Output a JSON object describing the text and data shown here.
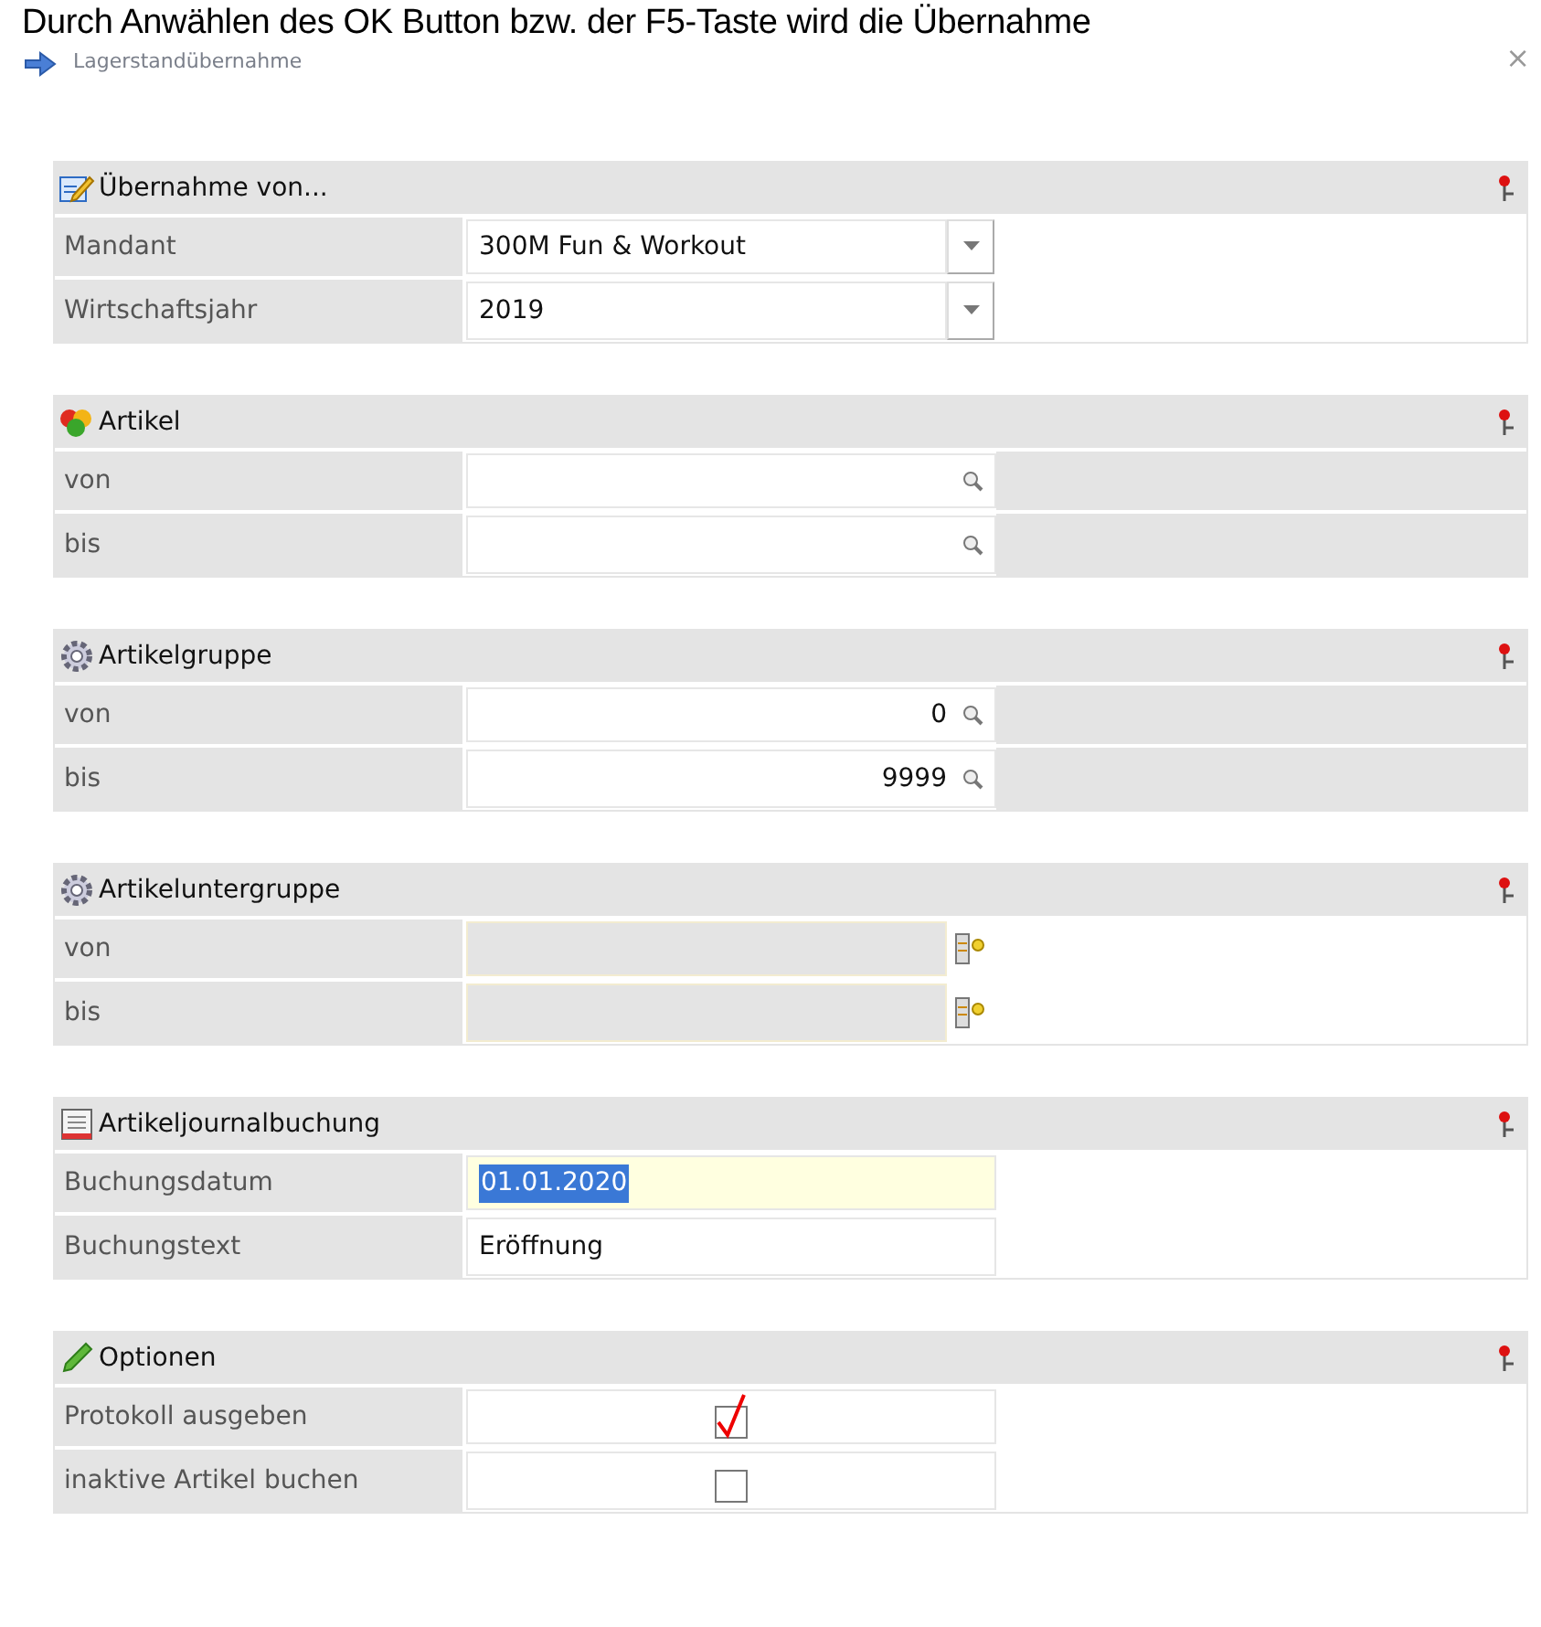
{
  "overlay_text": "Durch Anwählen des OK Button bzw. der F5-Taste wird die Übernahme",
  "window": {
    "title": "Lagerstandübernahme",
    "close": "×"
  },
  "sections": [
    {
      "title": "Übernahme von...",
      "shaded": false,
      "rows": [
        {
          "label": "Mandant",
          "kind": "select",
          "value": "300M Fun & Workout"
        },
        {
          "label": "Wirtschaftsjahr",
          "kind": "select",
          "value": "2019"
        }
      ]
    },
    {
      "title": "Artikel",
      "shaded": true,
      "rows": [
        {
          "label": "von",
          "kind": "lookup"
        },
        {
          "label": "bis",
          "kind": "lookup"
        }
      ]
    },
    {
      "title": "Artikelgruppe",
      "shaded": true,
      "rows": [
        {
          "label": "von",
          "kind": "lookup",
          "value": "0"
        },
        {
          "label": "bis",
          "kind": "lookup",
          "value": "9999"
        }
      ]
    },
    {
      "title": "Artikeluntergruppe",
      "shaded": false,
      "rows": [
        {
          "label": "von",
          "kind": "picker",
          "disabled": true
        },
        {
          "label": "bis",
          "kind": "picker",
          "disabled": true
        }
      ]
    },
    {
      "title": "Artikeljournalbuchung",
      "shaded": false,
      "rows": [
        {
          "label": "Buchungsdatum",
          "kind": "text",
          "value": "01.01.2020",
          "focused": true
        },
        {
          "label": "Buchungstext",
          "kind": "text",
          "value": "Eröffnung",
          "focused": false
        }
      ]
    },
    {
      "title": "Optionen",
      "shaded": false,
      "rows": [
        {
          "label": "Protokoll ausgeben",
          "kind": "checkbox",
          "checked": true
        },
        {
          "label": "inaktive Artikel buchen",
          "kind": "checkbox",
          "checked": false
        }
      ]
    }
  ]
}
